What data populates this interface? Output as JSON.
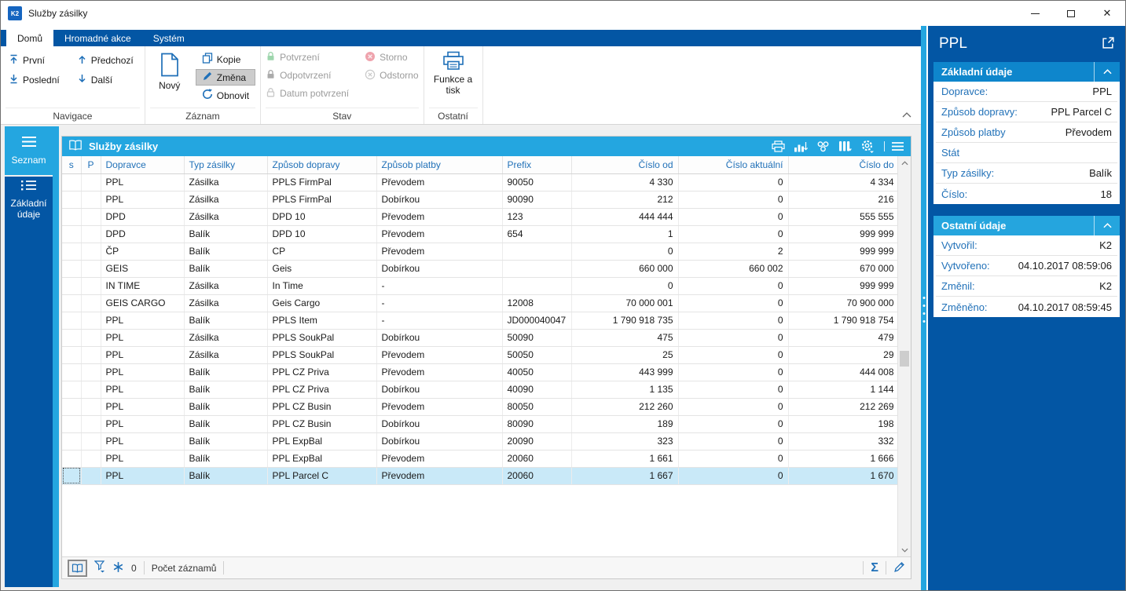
{
  "window": {
    "title": "Služby zásilky"
  },
  "colors": {
    "dark_blue": "#0356A4",
    "accent_blue": "#24A6E0",
    "selected_row": "#C9E9F8",
    "link_blue": "#2171B8"
  },
  "ribbon": {
    "tabs": [
      {
        "label": "Domů",
        "active": true
      },
      {
        "label": "Hromadné akce",
        "active": false
      },
      {
        "label": "Systém",
        "active": false
      }
    ],
    "navigace": {
      "label": "Navigace",
      "first": "První",
      "last": "Poslední",
      "previous": "Předchozí",
      "next": "Další"
    },
    "zaznam": {
      "label": "Záznam",
      "new": "Nový",
      "copy": "Kopie",
      "change": "Změna",
      "refresh": "Obnovit"
    },
    "stav": {
      "label": "Stav",
      "confirm": "Potvrzení",
      "unconfirm": "Odpotvrzení",
      "confirm_date": "Datum potvrzení",
      "storno": "Storno",
      "odstorno": "Odstorno"
    },
    "ostatni": {
      "label": "Ostatní",
      "functions_print": "Funkce a tisk"
    }
  },
  "sidebar": {
    "items": [
      {
        "label": "Seznam",
        "icon": "hamburger-icon",
        "active": true
      },
      {
        "label": "Základní údaje",
        "icon": "detail-list-icon",
        "active": false
      }
    ]
  },
  "table": {
    "title": "Služby zásilky",
    "toolbar_icons": [
      "print",
      "chart",
      "relations",
      "columns",
      "settings",
      "menu"
    ],
    "columns": [
      "s",
      "P",
      "Dopravce",
      "Typ zásilky",
      "Způsob dopravy",
      "Způsob platby",
      "Prefix",
      "Číslo od",
      "Číslo aktuální",
      "Číslo do"
    ],
    "column_align": [
      "c",
      "c",
      "l",
      "l",
      "l",
      "l",
      "l",
      "r",
      "r",
      "r"
    ],
    "selected_row_index": 17,
    "rows": [
      [
        "",
        "",
        "PPL",
        "Zásilka",
        "PPLS FirmPal",
        "Převodem",
        "90050",
        "4 330",
        "0",
        "4 334"
      ],
      [
        "",
        "",
        "PPL",
        "Zásilka",
        "PPLS FirmPal",
        "Dobírkou",
        "90090",
        "212",
        "0",
        "216"
      ],
      [
        "",
        "",
        "DPD",
        "Zásilka",
        "DPD 10",
        "Převodem",
        "123",
        "444 444",
        "0",
        "555 555"
      ],
      [
        "",
        "",
        "DPD",
        "Balík",
        "DPD 10",
        "Převodem",
        "654",
        "1",
        "0",
        "999 999"
      ],
      [
        "",
        "",
        "ČP",
        "Balík",
        "CP",
        "Převodem",
        "",
        "0",
        "2",
        "999 999"
      ],
      [
        "",
        "",
        "GEIS",
        "Balík",
        "Geis",
        "Dobírkou",
        "",
        "660 000",
        "660 002",
        "670 000"
      ],
      [
        "",
        "",
        "IN TIME",
        "Zásilka",
        "In Time",
        "-",
        "",
        "0",
        "0",
        "999 999"
      ],
      [
        "",
        "",
        "GEIS CARGO",
        "Zásilka",
        "Geis Cargo",
        "-",
        "12008",
        "70 000 001",
        "0",
        "70 900 000"
      ],
      [
        "",
        "",
        "PPL",
        "Balík",
        "PPLS Item",
        "-",
        "JD000040047",
        "1 790 918 735",
        "0",
        "1 790 918 754"
      ],
      [
        "",
        "",
        "PPL",
        "Zásilka",
        "PPLS SoukPal",
        "Dobírkou",
        "50090",
        "475",
        "0",
        "479"
      ],
      [
        "",
        "",
        "PPL",
        "Zásilka",
        "PPLS SoukPal",
        "Převodem",
        "50050",
        "25",
        "0",
        "29"
      ],
      [
        "",
        "",
        "PPL",
        "Balík",
        "PPL CZ Priva",
        "Převodem",
        "40050",
        "443 999",
        "0",
        "444 008"
      ],
      [
        "",
        "",
        "PPL",
        "Balík",
        "PPL CZ Priva",
        "Dobírkou",
        "40090",
        "1 135",
        "0",
        "1 144"
      ],
      [
        "",
        "",
        "PPL",
        "Balík",
        "PPL CZ Busin",
        "Převodem",
        "80050",
        "212 260",
        "0",
        "212 269"
      ],
      [
        "",
        "",
        "PPL",
        "Balík",
        "PPL CZ Busin",
        "Dobírkou",
        "80090",
        "189",
        "0",
        "198"
      ],
      [
        "",
        "",
        "PPL",
        "Balík",
        "PPL ExpBal",
        "Dobírkou",
        "20090",
        "323",
        "0",
        "332"
      ],
      [
        "",
        "",
        "PPL",
        "Balík",
        "PPL ExpBal",
        "Převodem",
        "20060",
        "1 661",
        "0",
        "1 666"
      ],
      [
        "",
        "",
        "PPL",
        "Balík",
        "PPL Parcel C",
        "Převodem",
        "20060",
        "1 667",
        "0",
        "1 670"
      ]
    ]
  },
  "statusbar": {
    "left_icons": [
      "book",
      "filter",
      "snowflake"
    ],
    "filter_count": "0",
    "count_label": "Počet záznamů",
    "right_icons": [
      "sum",
      "edit"
    ]
  },
  "panel": {
    "title": "PPL",
    "sections": [
      {
        "title": "Základní údaje",
        "header_color": "#0E86CC",
        "fields": [
          {
            "label": "Dopravce:",
            "value": "PPL"
          },
          {
            "label": "Způsob dopravy:",
            "value": "PPL Parcel C"
          },
          {
            "label": "Způsob platby",
            "value": "Převodem"
          },
          {
            "label": "Stát",
            "value": ""
          },
          {
            "label": "Typ zásilky:",
            "value": "Balík"
          },
          {
            "label": "Číslo:",
            "value": "18"
          }
        ]
      },
      {
        "title": "Ostatní údaje",
        "header_color": "#25A5DE",
        "fields": [
          {
            "label": "Vytvořil:",
            "value": "K2"
          },
          {
            "label": "Vytvořeno:",
            "value": "04.10.2017 08:59:06"
          },
          {
            "label": "Změnil:",
            "value": "K2"
          },
          {
            "label": "Změněno:",
            "value": "04.10.2017 08:59:45"
          }
        ]
      }
    ]
  }
}
